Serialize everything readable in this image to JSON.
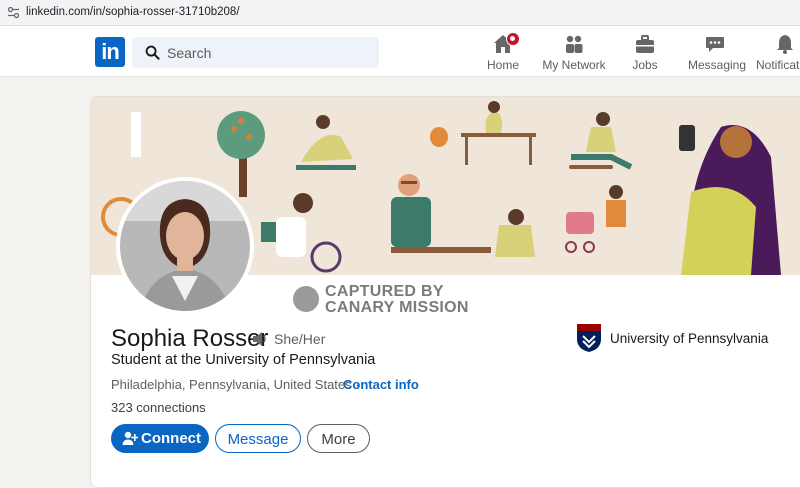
{
  "browser": {
    "url": "linkedin.com/in/sophia-rosser-31710b208/"
  },
  "header": {
    "logo_text": "in",
    "search": {
      "placeholder": "Search"
    },
    "nav": [
      {
        "label": "Home",
        "icon": "home-icon"
      },
      {
        "label": "My Network",
        "icon": "network-icon"
      },
      {
        "label": "Jobs",
        "icon": "briefcase-icon"
      },
      {
        "label": "Messaging",
        "icon": "chat-icon"
      },
      {
        "label": "Notificati",
        "icon": "bell-icon"
      }
    ]
  },
  "watermark": {
    "line1": "CAPTURED BY",
    "line2": "CANARY MISSION"
  },
  "profile": {
    "name": "Sophia Rosser",
    "pronouns": "She/Her",
    "headline": "Student at the University of Pennsylvania",
    "location": "Philadelphia, Pennsylvania, United States",
    "separator": "·",
    "contact_info": "Contact info",
    "connections": "323 connections",
    "education": "University of Pennsylvania"
  },
  "actions": {
    "connect": "Connect",
    "message": "Message",
    "more": "More"
  },
  "colors": {
    "brand": "#0a66c2",
    "banner_bg": "#efe6d9",
    "notification": "#cb112d"
  }
}
